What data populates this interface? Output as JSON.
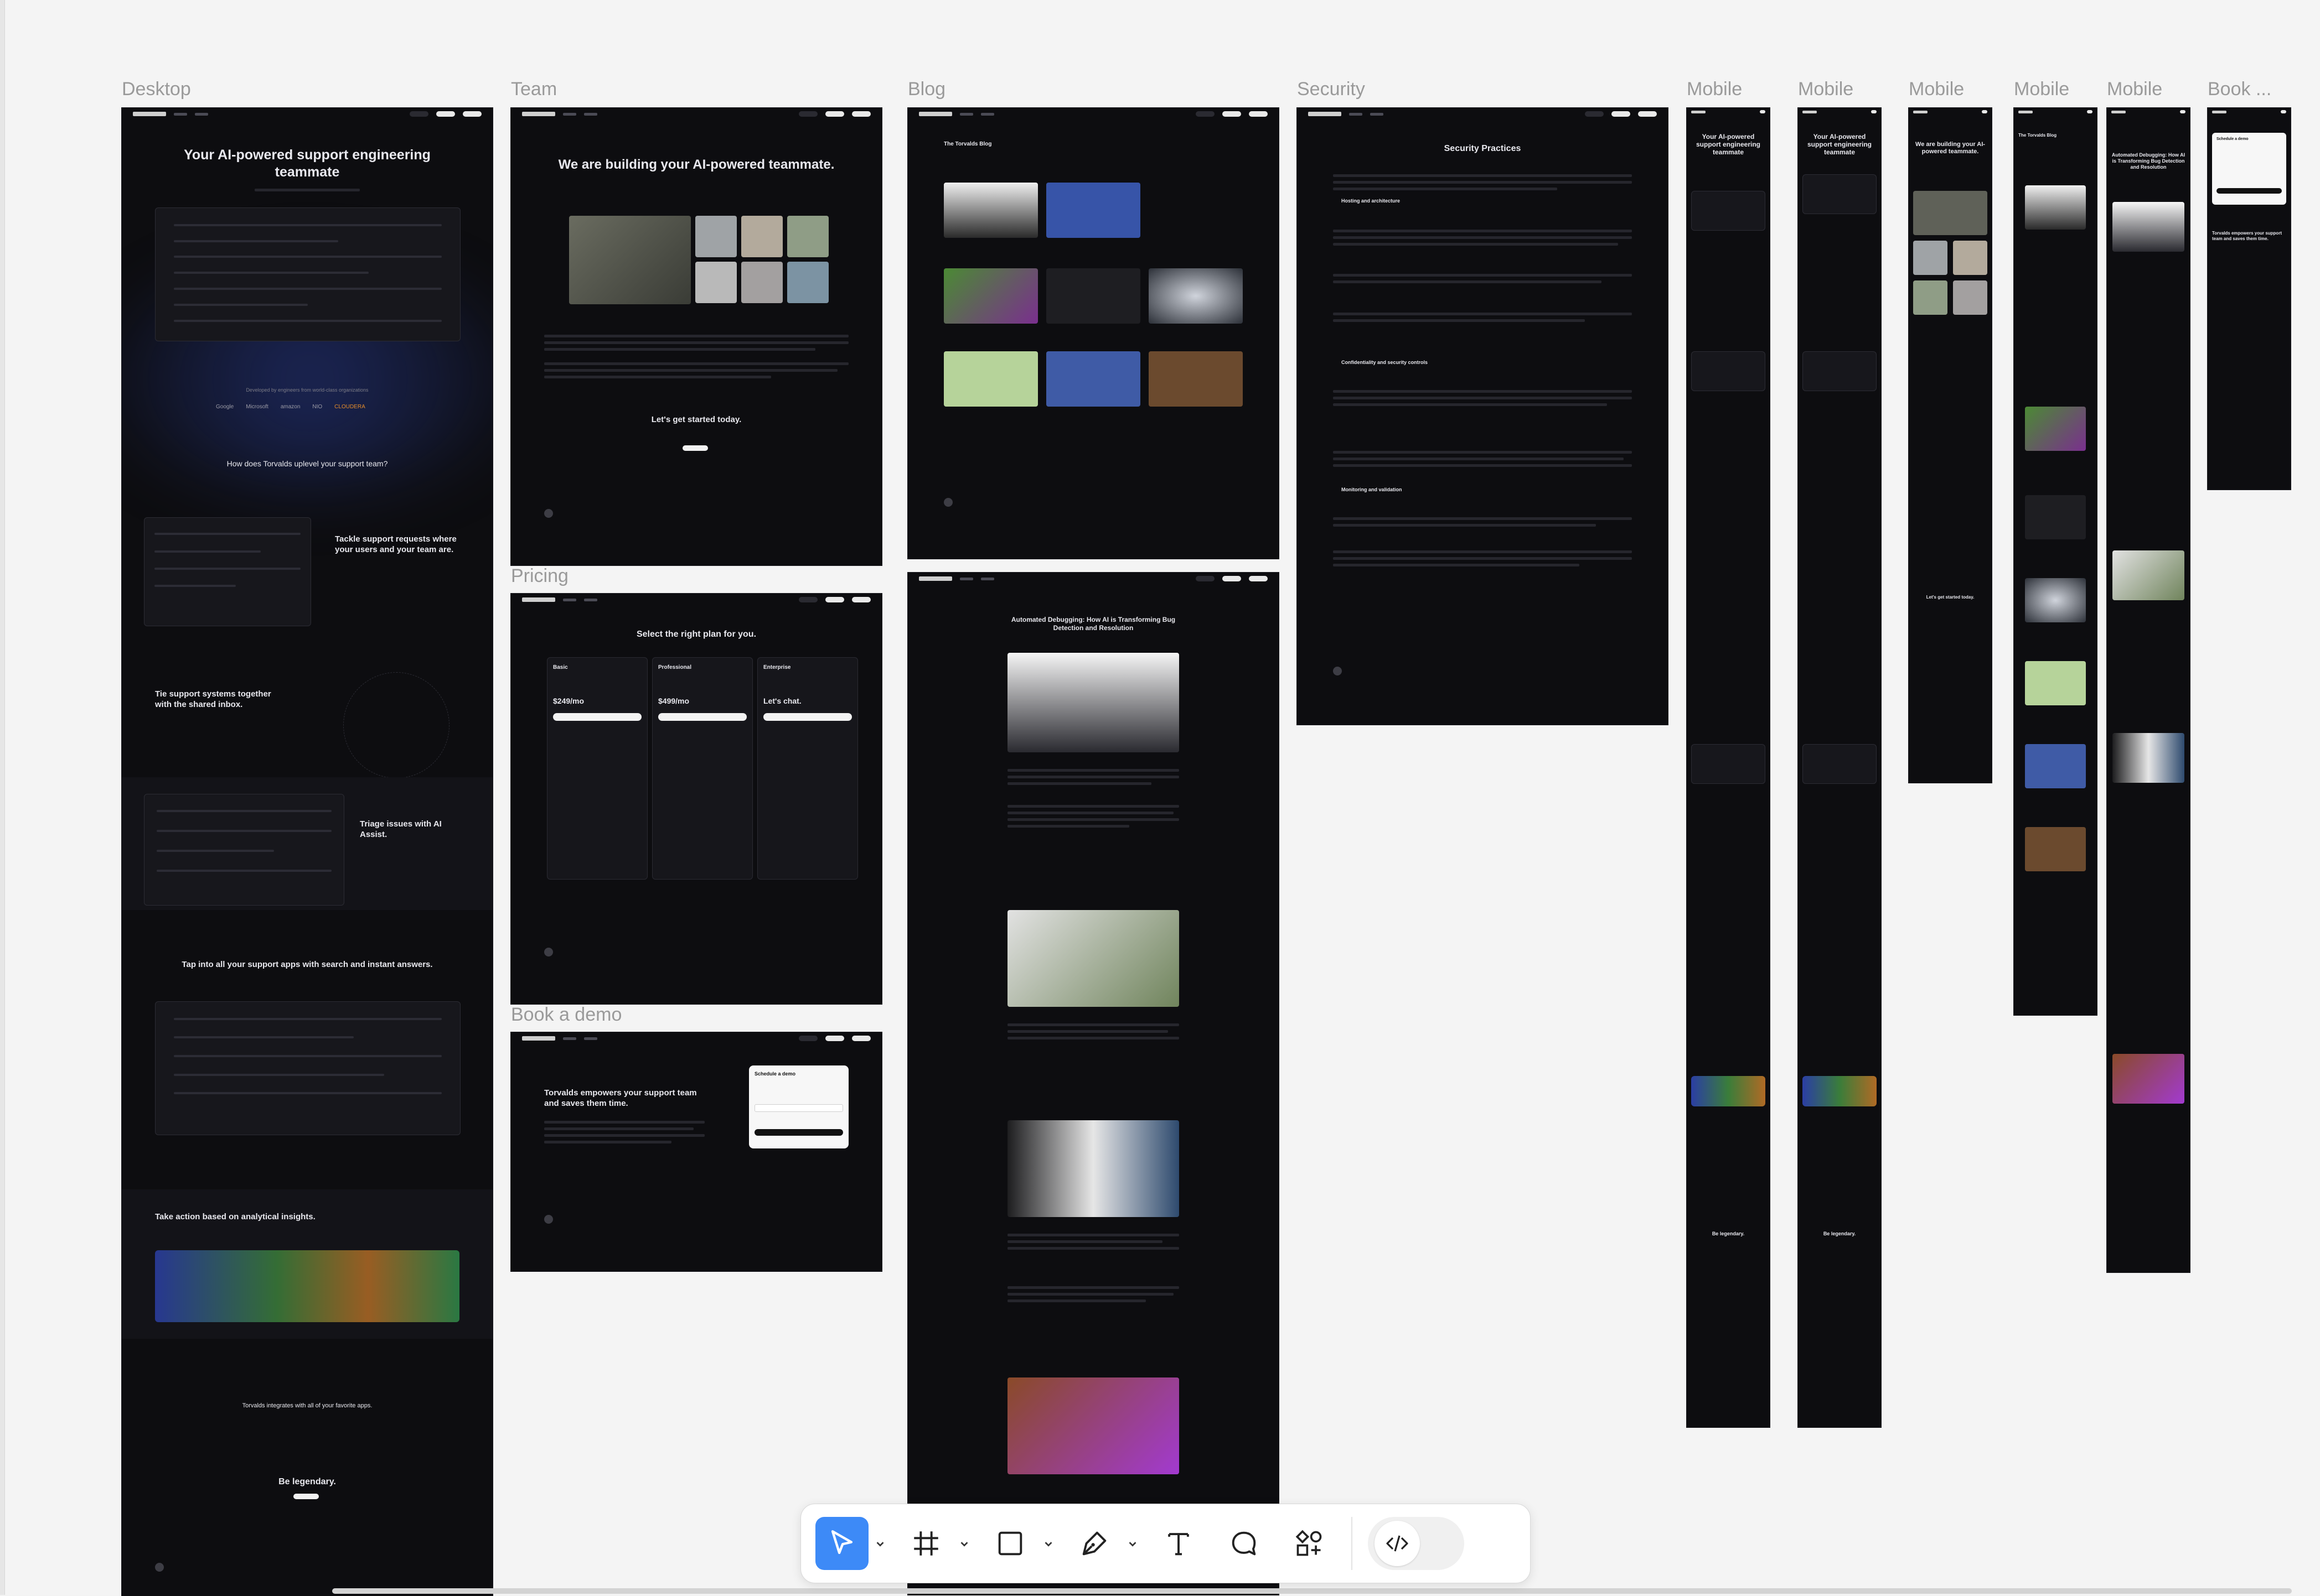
{
  "frames": {
    "desktop": {
      "label": "Desktop",
      "hero_title": "Your AI-powered support engineering teammate",
      "trusted": "Developed by engineers from world-class organizations",
      "logos": [
        "Google",
        "Microsoft",
        "amazon",
        "NIO",
        "CLOUDERA"
      ],
      "how_title": "How does Torvalds uplevel your support team?",
      "feature_1": "Tackle support requests where your users and your team are.",
      "feature_2": "Tie support systems together with the shared inbox.",
      "feature_3": "Triage issues with AI Assist.",
      "feature_4": "Tap into all your support apps with search and instant answers.",
      "feature_5": "Take action based on analytical insights.",
      "integrations": "Torvalds integrates with all of your favorite apps.",
      "cta": "Be legendary."
    },
    "team": {
      "label": "Team",
      "title": "We are building your AI-powered teammate.",
      "cta": "Let's get started today."
    },
    "pricing": {
      "label": "Pricing",
      "title": "Select the right plan for you.",
      "plans": [
        {
          "name": "Basic",
          "price": "$249/mo"
        },
        {
          "name": "Professional",
          "price": "$499/mo"
        },
        {
          "name": "Enterprise",
          "price": "Let's chat."
        }
      ]
    },
    "book_demo": {
      "label": "Book a demo",
      "title": "Torvalds empowers your support team and saves them time.",
      "form_title": "Schedule a demo"
    },
    "blog": {
      "label": "Blog",
      "title": "The Torvalds Blog",
      "post_title": "Automated Debugging: How AI is Transforming Bug Detection and Resolution"
    },
    "security": {
      "label": "Security",
      "title": "Security Practices",
      "sections": [
        "Hosting and architecture",
        "Confidentiality and security controls",
        "Monitoring and validation"
      ]
    },
    "mobile_labels": [
      "Mobile",
      "Mobile",
      "Mobile",
      "Mobile",
      "Mobile"
    ],
    "book_mobile_label": "Book ..."
  },
  "toolbar": {
    "tools": [
      "move-tool",
      "frame-tool",
      "shape-tool",
      "pen-tool",
      "text-tool",
      "comment-tool",
      "components-tool",
      "dev-mode-toggle"
    ],
    "active_tool": "move-tool",
    "accent": "#3d8af7"
  }
}
